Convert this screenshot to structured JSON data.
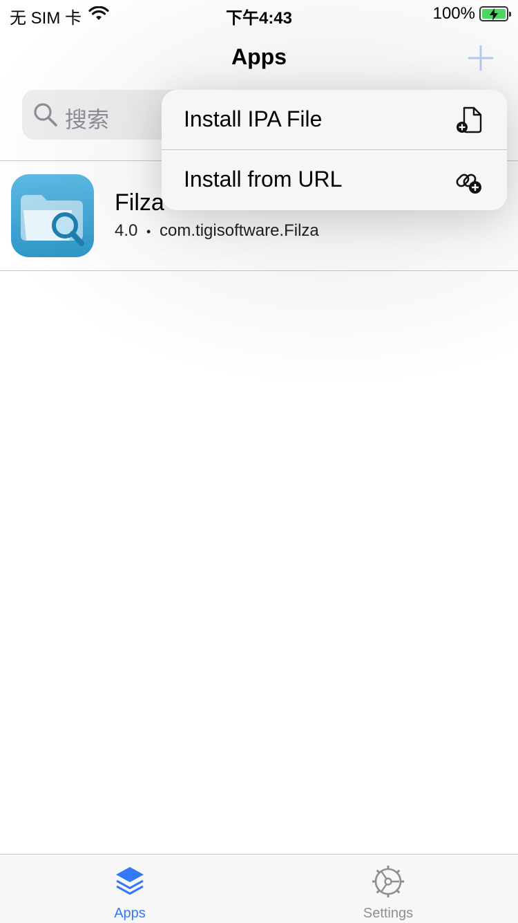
{
  "status": {
    "carrier": "无 SIM 卡",
    "time": "下午4:43",
    "battery": "100%"
  },
  "nav": {
    "title": "Apps",
    "add_icon": "plus-icon"
  },
  "search": {
    "placeholder": "搜索"
  },
  "apps": [
    {
      "name": "Filza",
      "version": "4.0",
      "separator": "•",
      "bundle_id": "com.tigisoftware.Filza"
    }
  ],
  "menu": {
    "items": [
      {
        "label": "Install IPA File",
        "icon": "doc-plus-icon"
      },
      {
        "label": "Install from URL",
        "icon": "link-plus-icon"
      }
    ]
  },
  "tabbar": {
    "tabs": [
      {
        "label": "Apps",
        "icon": "stack-icon",
        "active": true
      },
      {
        "label": "Settings",
        "icon": "gear-icon",
        "active": false
      }
    ]
  },
  "colors": {
    "accent": "#3478f6",
    "inactive": "#8e8e93",
    "app_icon": "#4aaedc"
  }
}
